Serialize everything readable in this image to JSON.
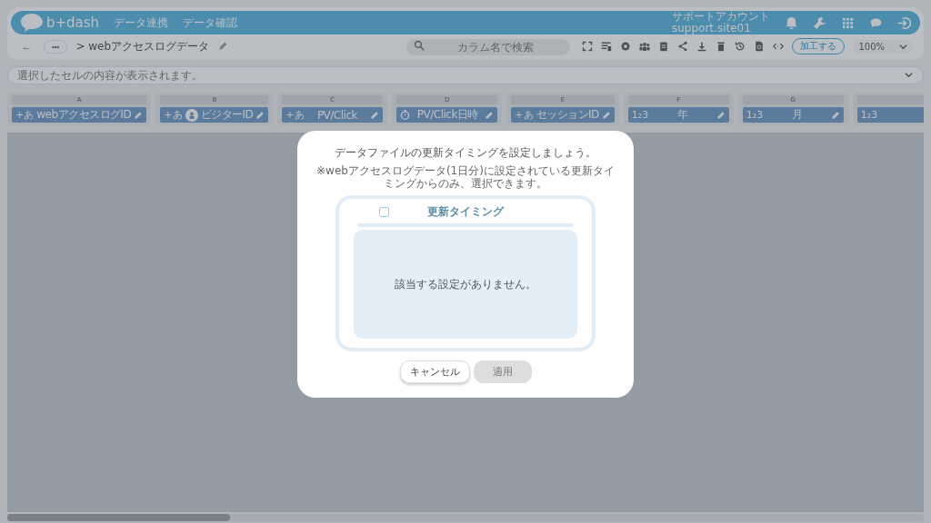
{
  "header": {
    "logo": "b+dash",
    "nav": [
      "データ連携",
      "データ確認"
    ],
    "account": {
      "name": "サポートアカウント",
      "id": "support.site01"
    }
  },
  "toolbar": {
    "back": "←",
    "more": "•••",
    "breadcrumb": "> webアクセスログデータ",
    "search": {
      "placeholder": "カラム名で検索"
    },
    "process_button": "加工する",
    "zoom": "100%"
  },
  "cell_bar": {
    "placeholder": "選択したセルの内容が表示されます。"
  },
  "columns": [
    {
      "letter": "A",
      "kind": "text",
      "type_label": "+あ",
      "name": "webアクセスログID",
      "people": false
    },
    {
      "letter": "B",
      "kind": "text",
      "type_label": "+あ",
      "name": "ビジターID",
      "people": true
    },
    {
      "letter": "C",
      "kind": "text",
      "type_label": "+あ",
      "name": "PV/Click",
      "people": false
    },
    {
      "letter": "D",
      "kind": "datetime",
      "name": "PV/Click日時",
      "people": false
    },
    {
      "letter": "E",
      "kind": "text",
      "type_label": "+あ",
      "name": "セッションID",
      "people": false
    },
    {
      "letter": "F",
      "kind": "number",
      "type_label": "1₂3",
      "name": "年",
      "people": false
    },
    {
      "letter": "G",
      "kind": "number",
      "type_label": "1₂3",
      "name": "月",
      "people": false
    },
    {
      "kind": "number",
      "type_label": "1₂3",
      "people": false
    }
  ],
  "dialog": {
    "title": "データファイルの更新タイミングを設定しましょう。",
    "note": "※webアクセスログデータ(1日分)に設定されている更新タイミングからのみ、選択できます。",
    "table": {
      "checked": false,
      "header": "更新タイミング",
      "empty": "該当する設定がありません。"
    },
    "buttons": [
      {
        "label": "キャンセル",
        "disabled": false
      },
      {
        "label": "適用",
        "disabled": true
      }
    ]
  }
}
